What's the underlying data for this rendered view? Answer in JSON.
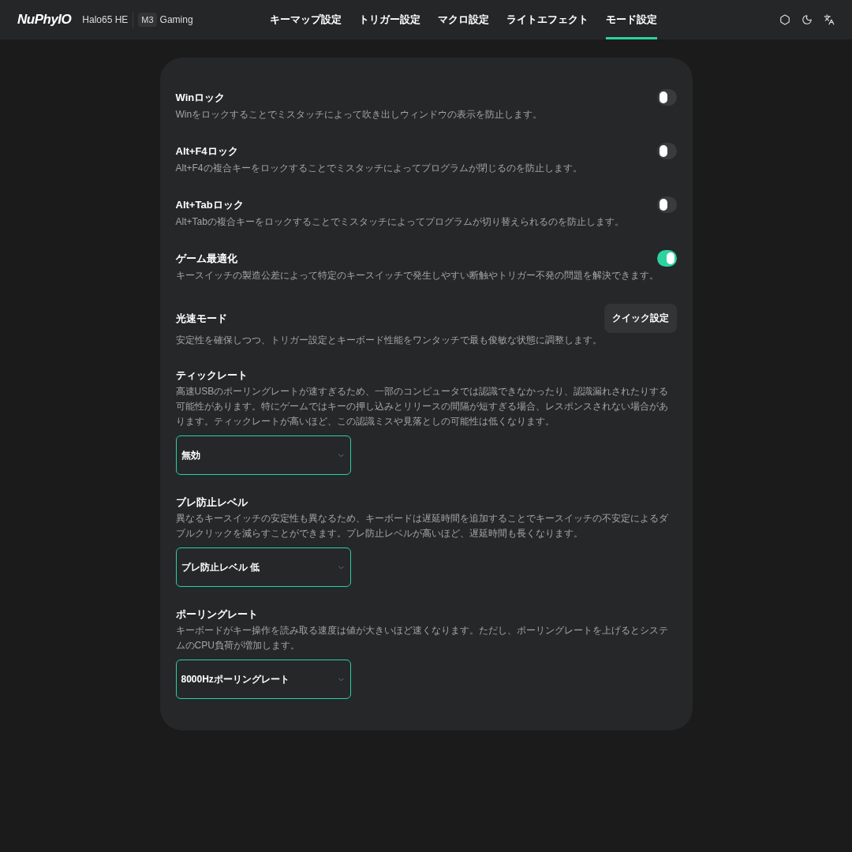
{
  "header": {
    "logo": "NuPhyIO",
    "device": "Halo65 HE",
    "mode_badge": "M3",
    "mode": "Gaming"
  },
  "tabs": [
    {
      "label": "キーマップ設定",
      "selected": false
    },
    {
      "label": "トリガー設定",
      "selected": false
    },
    {
      "label": "マクロ設定",
      "selected": false
    },
    {
      "label": "ライトエフェクト",
      "selected": false
    },
    {
      "label": "モード設定",
      "selected": true
    }
  ],
  "settings": [
    {
      "kind": "toggle",
      "title": "Winロック",
      "description": "Winをロックすることでミスタッチによって吹き出しウィンドウの表示を防止します。",
      "on": false
    },
    {
      "kind": "toggle",
      "title": "Alt+F4ロック",
      "description": "Alt+F4の複合キーをロックすることでミスタッチによってプログラムが閉じるのを防止します。",
      "on": false
    },
    {
      "kind": "toggle",
      "title": "Alt+Tabロック",
      "description": "Alt+Tabの複合キーをロックすることでミスタッチによってプログラムが切り替えられるのを防止します。",
      "on": false
    },
    {
      "kind": "toggle",
      "title": "ゲーム最適化",
      "description": "キースイッチの製造公差によって特定のキースイッチで発生しやすい断触やトリガー不発の問題を解決できます。",
      "on": true
    },
    {
      "kind": "button",
      "title": "光速モード",
      "description": "安定性を確保しつつ、トリガー設定とキーボード性能をワンタッチで最も俊敏な状態に調整します。",
      "button": "クイック設定"
    },
    {
      "kind": "select",
      "title": "ティックレート",
      "description": "高速USBのポーリングレートが速すぎるため、一部のコンピュータでは認識できなかったり、認識漏れされたりする可能性があります。特にゲームではキーの押し込みとリリースの間隔が短すぎる場合、レスポンスされない場合があります。ティックレートが高いほど、この認識ミスや見落としの可能性は低くなります。",
      "value": "無効"
    },
    {
      "kind": "select",
      "title": "ブレ防止レベル",
      "description": "異なるキースイッチの安定性も異なるため、キーボードは遅延時間を追加することでキースイッチの不安定によるダブルクリックを減らすことができます。ブレ防止レベルが高いほど、遅延時間も長くなります。",
      "value": "ブレ防止レベル 低"
    },
    {
      "kind": "select",
      "title": "ポーリングレート",
      "description": "キーボードがキー操作を読み取る速度は値が大きいほど速くなります。ただし、ポーリングレートを上げるとシステムのCPU負荷が増加します。",
      "value": "8000Hzポーリングレート"
    }
  ]
}
